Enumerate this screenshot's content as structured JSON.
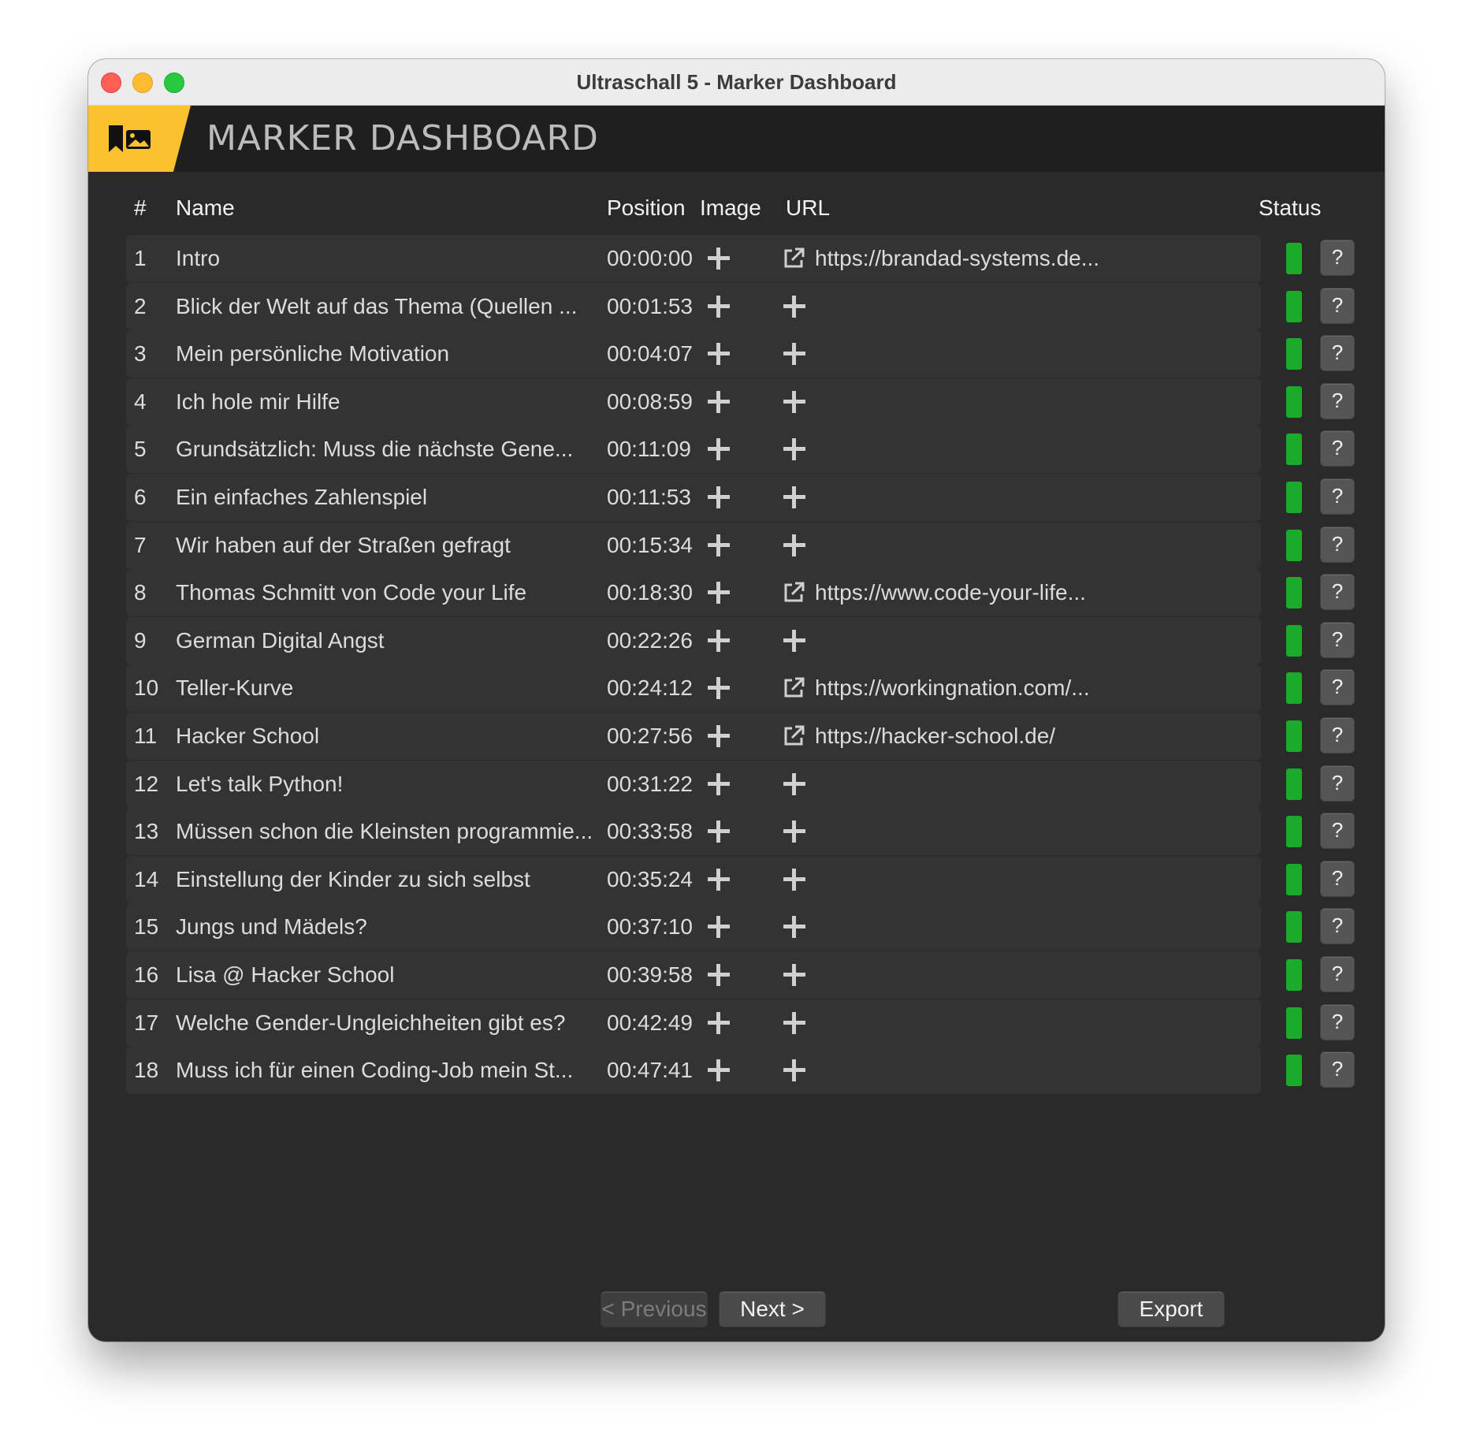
{
  "window": {
    "title": "Ultraschall 5 - Marker Dashboard"
  },
  "header": {
    "title": "MARKER DASHBOARD",
    "logo_icon": "marker-image-icon",
    "accent_color": "#fbc12e"
  },
  "table": {
    "columns": {
      "number": "#",
      "name": "Name",
      "position": "Position",
      "image": "Image",
      "url": "URL",
      "status": "Status"
    },
    "rows": [
      {
        "num": "1",
        "name": "Intro",
        "position": "00:00:00",
        "url": "https://brandad-systems.de...",
        "status": "green"
      },
      {
        "num": "2",
        "name": "Blick der Welt auf das Thema (Quellen ...",
        "position": "00:01:53",
        "url": "",
        "status": "green"
      },
      {
        "num": "3",
        "name": "Mein persönliche Motivation",
        "position": "00:04:07",
        "url": "",
        "status": "green"
      },
      {
        "num": "4",
        "name": "Ich hole mir Hilfe",
        "position": "00:08:59",
        "url": "",
        "status": "green"
      },
      {
        "num": "5",
        "name": "Grundsätzlich: Muss die nächste Gene...",
        "position": "00:11:09",
        "url": "",
        "status": "green"
      },
      {
        "num": "6",
        "name": "Ein einfaches Zahlenspiel",
        "position": "00:11:53",
        "url": "",
        "status": "green"
      },
      {
        "num": "7",
        "name": "Wir haben auf der Straßen gefragt",
        "position": "00:15:34",
        "url": "",
        "status": "green"
      },
      {
        "num": "8",
        "name": "Thomas Schmitt von Code your Life",
        "position": "00:18:30",
        "url": "https://www.code-your-life...",
        "status": "green"
      },
      {
        "num": "9",
        "name": "German Digital Angst",
        "position": "00:22:26",
        "url": "",
        "status": "green"
      },
      {
        "num": "10",
        "name": "Teller-Kurve",
        "position": "00:24:12",
        "url": "https://workingnation.com/...",
        "status": "green"
      },
      {
        "num": "11",
        "name": "Hacker School",
        "position": "00:27:56",
        "url": "https://hacker-school.de/",
        "status": "green"
      },
      {
        "num": "12",
        "name": "Let's talk Python!",
        "position": "00:31:22",
        "url": "",
        "status": "green"
      },
      {
        "num": "13",
        "name": "Müssen schon die Kleinsten programmie...",
        "position": "00:33:58",
        "url": "",
        "status": "green"
      },
      {
        "num": "14",
        "name": "Einstellung der Kinder zu sich selbst",
        "position": "00:35:24",
        "url": "",
        "status": "green"
      },
      {
        "num": "15",
        "name": "Jungs und Mädels?",
        "position": "00:37:10",
        "url": "",
        "status": "green"
      },
      {
        "num": "16",
        "name": "Lisa @ Hacker School",
        "position": "00:39:58",
        "url": "",
        "status": "green"
      },
      {
        "num": "17",
        "name": "Welche Gender-Ungleichheiten gibt es?",
        "position": "00:42:49",
        "url": "",
        "status": "green"
      },
      {
        "num": "18",
        "name": "Muss ich für einen Coding-Job mein St...",
        "position": "00:47:41",
        "url": "",
        "status": "green"
      }
    ],
    "help_label": "?",
    "status_color": "#1bab2c"
  },
  "footer": {
    "previous_label": "< Previous",
    "next_label": "Next >",
    "export_label": "Export"
  }
}
